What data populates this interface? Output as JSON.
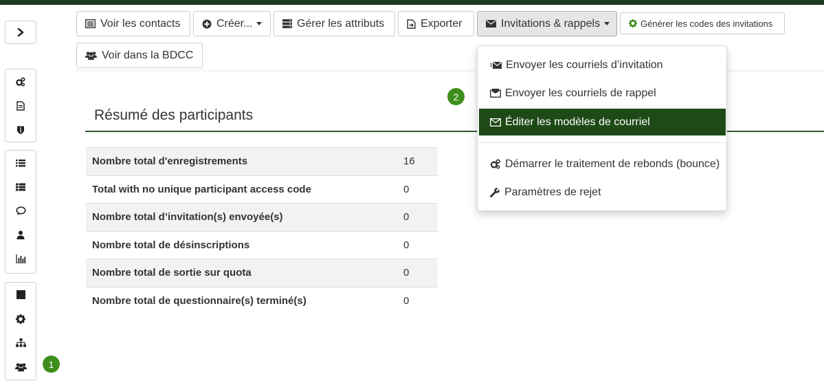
{
  "colors": {
    "accent": "#1e4a17",
    "badge": "#3f8e1d",
    "topbar": "#1e3a1e"
  },
  "sidebar": {
    "toggle_icon": "chevron-right-icon",
    "groups": [
      [
        "cogs-icon",
        "document-icon",
        "shield-icon"
      ],
      [
        "list-icon",
        "list-alt-icon",
        "comment-icon",
        "user-icon",
        "bar-chart-icon"
      ],
      [
        "square-icon",
        "gear-icon",
        "sitemap-icon",
        "users-icon"
      ]
    ]
  },
  "badges": {
    "one": "1",
    "two": "2"
  },
  "toolbar": {
    "view_contacts": "Voir les contacts",
    "create": "Créer...",
    "manage_attributes": "Gérer les attributs",
    "export": "Exporter",
    "invitations": "Invitations & rappels",
    "generate_codes": "Générer les codes des invitations",
    "view_cpdb": "Voir dans la BDCC"
  },
  "summary": {
    "title": "Résumé des participants",
    "rows": [
      {
        "label": "Nombre total d'enregistrements",
        "value": "16"
      },
      {
        "label": "Total with no unique participant access code",
        "value": "0"
      },
      {
        "label": "Nombre total d’invitation(s) envoyée(s)",
        "value": "0"
      },
      {
        "label": "Nombre total de désinscriptions",
        "value": "0"
      },
      {
        "label": "Nombre total de sortie sur quota",
        "value": "0"
      },
      {
        "label": "Nombre total de questionnaire(s) terminé(s)",
        "value": "0"
      }
    ]
  },
  "dropdown": {
    "items": [
      {
        "label": "Envoyer les courriels d’invitation",
        "icon": "envelope-send-icon"
      },
      {
        "label": "Envoyer les courriels de rappel",
        "icon": "envelope-reminder-icon"
      },
      {
        "label": "Éditer les modèles de courriel",
        "icon": "envelope-outline-icon",
        "active": true
      },
      {
        "label": "Démarrer le traitement de rebonds (bounce)",
        "icon": "cogs-icon"
      },
      {
        "label": "Paramètres de rejet",
        "icon": "wrench-icon"
      }
    ]
  }
}
